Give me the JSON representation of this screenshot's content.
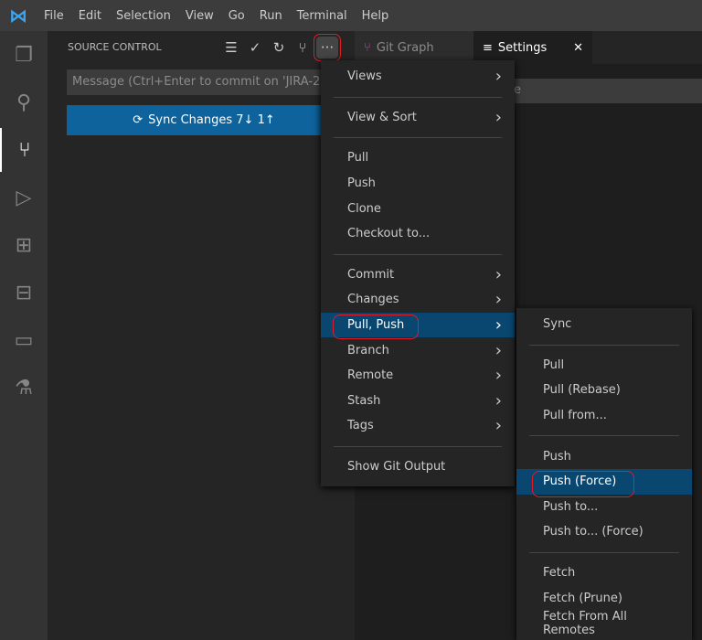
{
  "menubar": [
    "File",
    "Edit",
    "Selection",
    "View",
    "Go",
    "Run",
    "Terminal",
    "Help"
  ],
  "activity_icons": [
    "files-icon",
    "search-icon",
    "source-control-icon",
    "run-debug-icon",
    "extensions-icon",
    "remote-extensions-icon",
    "remote-explorer-icon",
    "testing-icon"
  ],
  "sidebar": {
    "title": "SOURCE CONTROL",
    "message_placeholder": "Message (Ctrl+Enter to commit on 'JIRA-20'",
    "sync_label": "Sync Changes 7↓ 1↑"
  },
  "tabs": [
    {
      "label": "Git Graph",
      "active": false
    },
    {
      "label": "Settings",
      "active": true
    }
  ],
  "settings_search_fragment": "e",
  "menu": [
    {
      "label": "Views",
      "sub": true
    },
    {
      "sep": true
    },
    {
      "label": "View & Sort",
      "sub": true
    },
    {
      "sep": true
    },
    {
      "label": "Pull"
    },
    {
      "label": "Push"
    },
    {
      "label": "Clone"
    },
    {
      "label": "Checkout to..."
    },
    {
      "sep": true
    },
    {
      "label": "Commit",
      "sub": true
    },
    {
      "label": "Changes",
      "sub": true
    },
    {
      "label": "Pull, Push",
      "sub": true,
      "selected": true
    },
    {
      "label": "Branch",
      "sub": true
    },
    {
      "label": "Remote",
      "sub": true
    },
    {
      "label": "Stash",
      "sub": true
    },
    {
      "label": "Tags",
      "sub": true
    },
    {
      "sep": true
    },
    {
      "label": "Show Git Output"
    }
  ],
  "submenu": [
    {
      "label": "Sync"
    },
    {
      "sep": true
    },
    {
      "label": "Pull"
    },
    {
      "label": "Pull (Rebase)"
    },
    {
      "label": "Pull from..."
    },
    {
      "sep": true
    },
    {
      "label": "Push"
    },
    {
      "label": "Push (Force)",
      "selected": true
    },
    {
      "label": "Push to..."
    },
    {
      "label": "Push to... (Force)"
    },
    {
      "sep": true
    },
    {
      "label": "Fetch"
    },
    {
      "label": "Fetch (Prune)"
    },
    {
      "label": "Fetch From All Remotes"
    }
  ],
  "colors": {
    "accent": "#0e639c",
    "selection": "#094771",
    "highlight": "#e51b23"
  }
}
